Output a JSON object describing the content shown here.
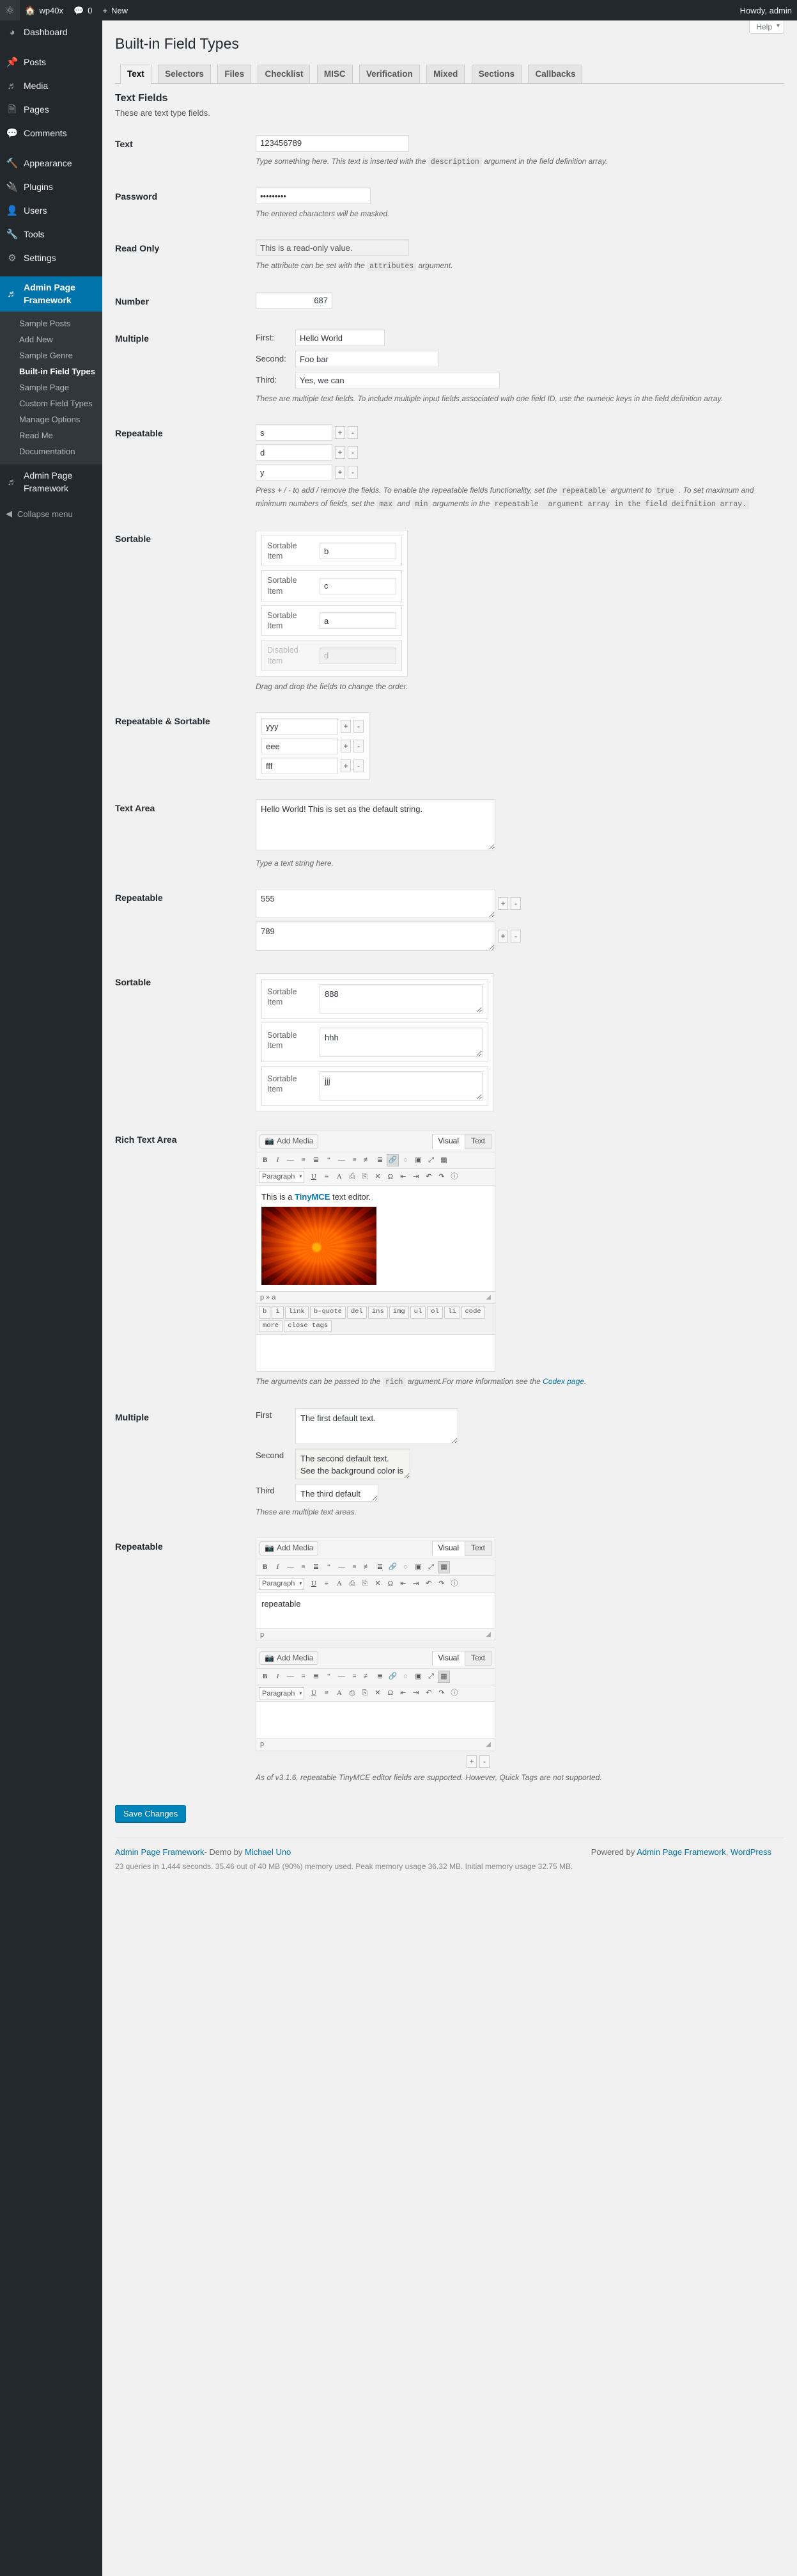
{
  "adminbar": {
    "logo_icon": "wordpress-logo-icon",
    "site_name": "wp40x",
    "comments_count": "0",
    "new_label": "New",
    "howdy": "Howdy, admin"
  },
  "sidebar": {
    "items": [
      {
        "label": "Dashboard",
        "icon": "dashboard-icon"
      },
      {
        "label": "Posts",
        "icon": "pin-icon"
      },
      {
        "label": "Media",
        "icon": "media-icon"
      },
      {
        "label": "Pages",
        "icon": "pages-icon"
      },
      {
        "label": "Comments",
        "icon": "comments-icon"
      },
      {
        "label": "Appearance",
        "icon": "appearance-icon"
      },
      {
        "label": "Plugins",
        "icon": "plugins-icon"
      },
      {
        "label": "Users",
        "icon": "users-icon"
      },
      {
        "label": "Tools",
        "icon": "tools-icon"
      },
      {
        "label": "Settings",
        "icon": "settings-icon"
      }
    ],
    "framework_menu": {
      "label": "Admin Page Framework",
      "icon": "framework-icon",
      "submenu": [
        "Sample Posts",
        "Add New",
        "Sample Genre",
        "Built-in Field Types",
        "Sample Page",
        "Custom Field Types",
        "Manage Options",
        "Read Me",
        "Documentation"
      ],
      "current_submenu": "Built-in Field Types"
    },
    "second_framework_menu": {
      "label": "Admin Page Framework",
      "icon": "framework-icon"
    },
    "collapse_label": "Collapse menu",
    "collapse_icon": "collapse-arrow-icon"
  },
  "screen": {
    "help_label": "Help",
    "page_title": "Built-in Field Types",
    "tabs": [
      "Text",
      "Selectors",
      "Files",
      "Checklist",
      "MISC",
      "Verification",
      "Mixed",
      "Sections",
      "Callbacks"
    ],
    "active_tab": "Text",
    "section_title": "Text Fields",
    "section_desc": "These are text type fields."
  },
  "fields": {
    "text": {
      "label": "Text",
      "value": "123456789",
      "desc_pre": "Type something here. This text is inserted with the",
      "desc_code": "description",
      "desc_post": "argument in the field definition array."
    },
    "password": {
      "label": "Password",
      "value": "•••••••••",
      "desc": "The entered characters will be masked."
    },
    "readonly": {
      "label": "Read Only",
      "value": "This is a read-only value.",
      "desc_pre": "The attribute can be set with the",
      "desc_code": "attributes",
      "desc_post": "argument."
    },
    "number": {
      "label": "Number",
      "value": "687"
    },
    "multiple": {
      "label": "Multiple",
      "rows": [
        {
          "label": "First:",
          "value": "Hello World"
        },
        {
          "label": "Second:",
          "value": "Foo bar"
        },
        {
          "label": "Third:",
          "value": "Yes, we can"
        }
      ],
      "desc": "These are multiple text fields. To include multiple input fields associated with one field ID, use the numeric keys in the field definition array."
    },
    "repeatable_text": {
      "label": "Repeatable",
      "values": [
        "s",
        "d",
        "y"
      ],
      "add_label": "+",
      "remove_label": "-",
      "desc_parts": [
        {
          "t": "Press + / - to add / remove the fields. To enable the repeatable fields functionality, set the ",
          "code": false
        },
        {
          "t": "repeatable",
          "code": true
        },
        {
          "t": " argument to ",
          "code": false
        },
        {
          "t": "true",
          "code": true
        },
        {
          "t": " . To set maximum and minimum numbers of fields, set the ",
          "code": false
        },
        {
          "t": "max",
          "code": true
        },
        {
          "t": " and ",
          "code": false
        },
        {
          "t": "min",
          "code": true
        },
        {
          "t": " arguments in the ",
          "code": false
        },
        {
          "t": "repeatable",
          "code": true
        },
        {
          "t": " argument array in the field deifnition array.",
          "code": true
        }
      ]
    },
    "sortable": {
      "label": "Sortable",
      "items": [
        {
          "label": "Sortable Item",
          "value": "b",
          "disabled": false
        },
        {
          "label": "Sortable Item",
          "value": "c",
          "disabled": false
        },
        {
          "label": "Sortable Item",
          "value": "a",
          "disabled": false
        },
        {
          "label": "Disabled Item",
          "value": "d",
          "disabled": true
        }
      ],
      "desc": "Drag and drop the fields to change the order."
    },
    "repeatable_sortable": {
      "label": "Repeatable & Sortable",
      "values": [
        "yyy",
        "eee",
        "fff"
      ],
      "add_label": "+",
      "remove_label": "-"
    },
    "textarea": {
      "label": "Text Area",
      "value": "Hello World! This is set as the default string.",
      "desc": "Type a text string here."
    },
    "textarea_repeatable": {
      "label": "Repeatable",
      "values": [
        "555",
        "789"
      ],
      "add_label": "+",
      "remove_label": "-"
    },
    "textarea_sortable": {
      "label": "Sortable",
      "items": [
        {
          "label": "Sortable Item",
          "value": "888"
        },
        {
          "label": "Sortable Item",
          "value": "hhh"
        },
        {
          "label": "Sortable Item",
          "value": "jjj"
        }
      ]
    },
    "rich": {
      "label": "Rich Text Area",
      "add_media": "Add Media",
      "tab_visual": "Visual",
      "tab_text": "Text",
      "active_tab": "Visual",
      "format_select": "Paragraph",
      "body_pre": "This is a ",
      "body_link": "TinyMCE",
      "body_post": " text editor.",
      "image_alt": "orange-chrysanthemum-photo",
      "statusbar_path": "p » a",
      "quicktags": [
        "b",
        "i",
        "link",
        "b-quote",
        "del",
        "ins",
        "img",
        "ul",
        "ol",
        "li",
        "code",
        "more",
        "close tags"
      ],
      "desc_pre": "The arguments can be passed to the",
      "desc_code": "rich",
      "desc_mid": "argument.For more information see the",
      "desc_link": "Codex page",
      "desc_post": "."
    },
    "rich_multiple": {
      "label": "Multiple",
      "rows": [
        {
          "label": "First",
          "value": "The first default text.",
          "highlight": false
        },
        {
          "label": "Second",
          "value": "The second default text. See the background color is different from the others. This is done with the attributes key.",
          "highlight": true
        },
        {
          "label": "Third",
          "value": "The third default text.",
          "highlight": false
        }
      ],
      "desc": "These are multiple text areas."
    },
    "rich_repeatable": {
      "label": "Repeatable",
      "add_media": "Add Media",
      "tab_visual": "Visual",
      "tab_text": "Text",
      "format_select": "Paragraph",
      "editors": [
        {
          "body": "repeatable",
          "statusbar_path": "p"
        },
        {
          "body": "",
          "statusbar_path": "p"
        }
      ],
      "add_label": "+",
      "remove_label": "-",
      "desc": "As of v3.1.6, repeatable TinyMCE editor fields are supported. However, Quick Tags are not supported."
    }
  },
  "submit": {
    "label": "Save Changes"
  },
  "footer": {
    "left_link1": "Admin Page Framework",
    "left_mid": "- Demo by ",
    "left_link2": "Michael Uno",
    "right_pre": "Powered by ",
    "right_link1": "Admin Page Framework",
    "right_sep": ", ",
    "right_link2": "WordPress",
    "stats": "23 queries in 1.444 seconds.    35.46 out of 40 MB (90%) memory used.    Peak memory usage 36.32 MB.    Initial memory usage 32.75 MB."
  },
  "colors": {
    "admin_blue": "#0073aa",
    "sidebar_bg": "#23282d",
    "page_bg": "#f1f1f1",
    "primary_button": "#0085ba"
  }
}
